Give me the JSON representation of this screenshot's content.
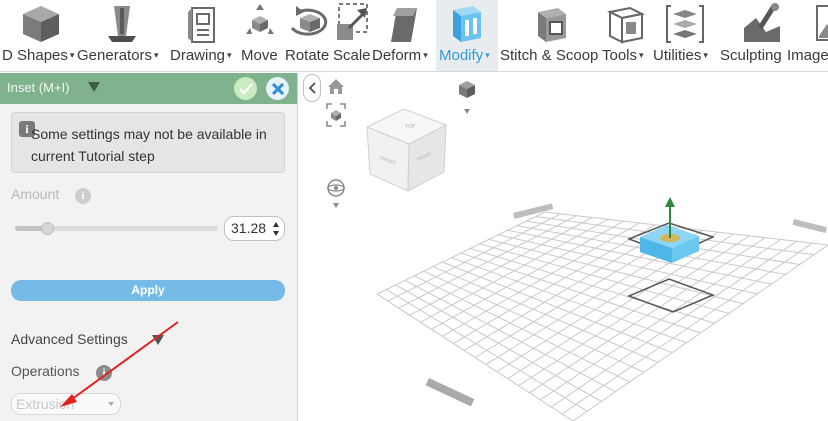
{
  "toolbar": {
    "items": [
      {
        "label": "D Shapes",
        "icon": "cube-icon",
        "dropdown": true
      },
      {
        "label": "Generators",
        "icon": "generator-icon",
        "dropdown": true
      },
      {
        "label": "Drawing",
        "icon": "drawing-icon",
        "dropdown": true
      },
      {
        "label": "Move",
        "icon": "move-icon",
        "dropdown": false
      },
      {
        "label": "Rotate",
        "icon": "rotate-icon",
        "dropdown": false
      },
      {
        "label": "Scale",
        "icon": "scale-icon",
        "dropdown": false
      },
      {
        "label": "Deform",
        "icon": "deform-icon",
        "dropdown": true
      },
      {
        "label": "Modify",
        "icon": "modify-icon",
        "dropdown": true,
        "active": true
      },
      {
        "label": "Stitch & Scoop",
        "icon": "stitch-scoop-icon",
        "dropdown": false
      },
      {
        "label": "Tools",
        "icon": "tools-icon",
        "dropdown": true
      },
      {
        "label": "Utilities",
        "icon": "utilities-icon",
        "dropdown": true
      },
      {
        "label": "Sculpting",
        "icon": "sculpting-icon",
        "dropdown": false
      },
      {
        "label": "Image",
        "icon": "image-icon",
        "dropdown": false
      }
    ],
    "caret": "▾"
  },
  "panel": {
    "title": "Inset (M+I)",
    "info_badge": "i",
    "info_text": "Some settings may not be available in current Tutorial step",
    "amount_label": "Amount",
    "help_glyph": "i",
    "amount_value": "31.28",
    "slider_fraction": 0.16,
    "apply_label": "Apply",
    "advanced_label": "Advanced Settings",
    "operations_label": "Operations",
    "operations_value": "Extrusion"
  },
  "viewcube": {
    "top": "TOP",
    "front": "FRONT",
    "right": "RIGHT"
  },
  "colors": {
    "accent": "#2f9bd8",
    "panel_header": "#7fb28d",
    "apply": "#76bbe8",
    "selection": "#6ac7ef",
    "arrow": "#e0231f"
  }
}
